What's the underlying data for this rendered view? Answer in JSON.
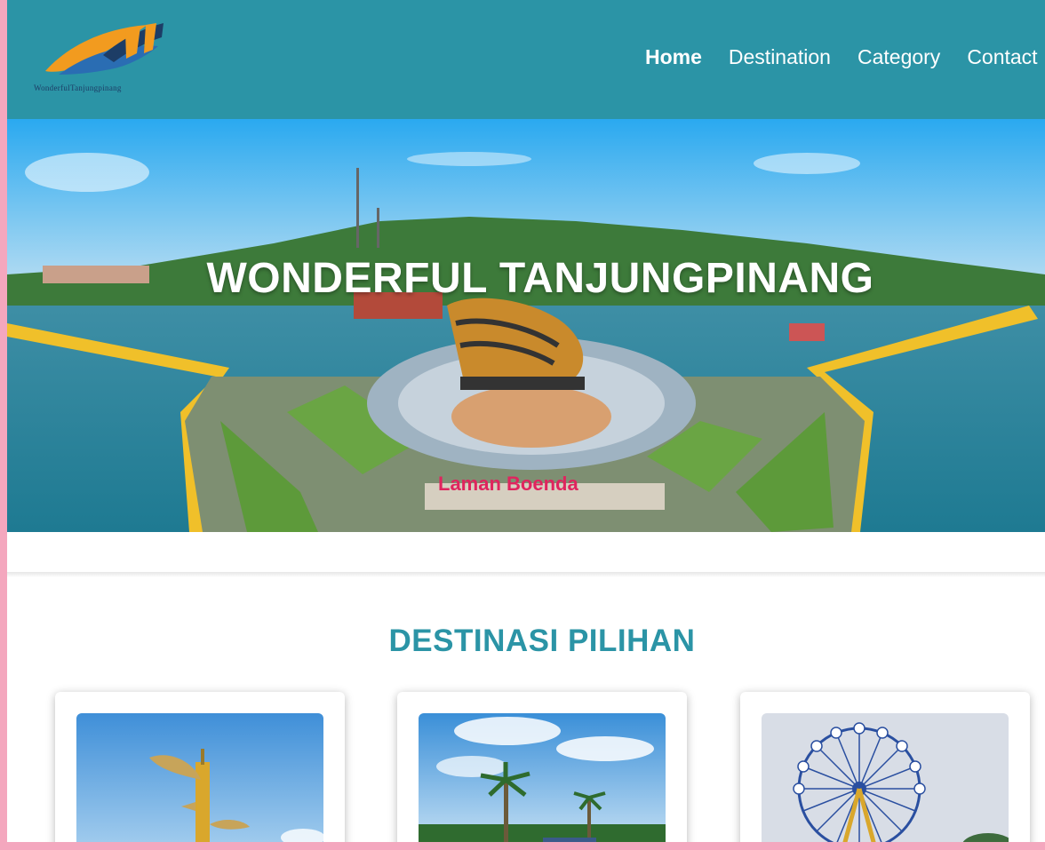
{
  "header": {
    "brand": "WonderfulTanjungpinang",
    "nav": [
      {
        "label": "Home",
        "active": true
      },
      {
        "label": "Destination",
        "active": false
      },
      {
        "label": "Category",
        "active": false
      },
      {
        "label": "Contact",
        "active": false
      }
    ]
  },
  "hero": {
    "title": "WONDERFUL TANJUNGPINANG",
    "sign_text": "Laman Boenda",
    "image": "aerial-waterfront-monument"
  },
  "section": {
    "title": "DESTINASI PILIHAN",
    "cards": [
      {
        "image": "golden-tower-sculpture"
      },
      {
        "image": "palm-trees-beach"
      },
      {
        "image": "ferris-wheel"
      }
    ]
  },
  "colors": {
    "header_bg": "#2b94a6",
    "accent": "#2b94a6",
    "page_border": "#f4a7be"
  }
}
